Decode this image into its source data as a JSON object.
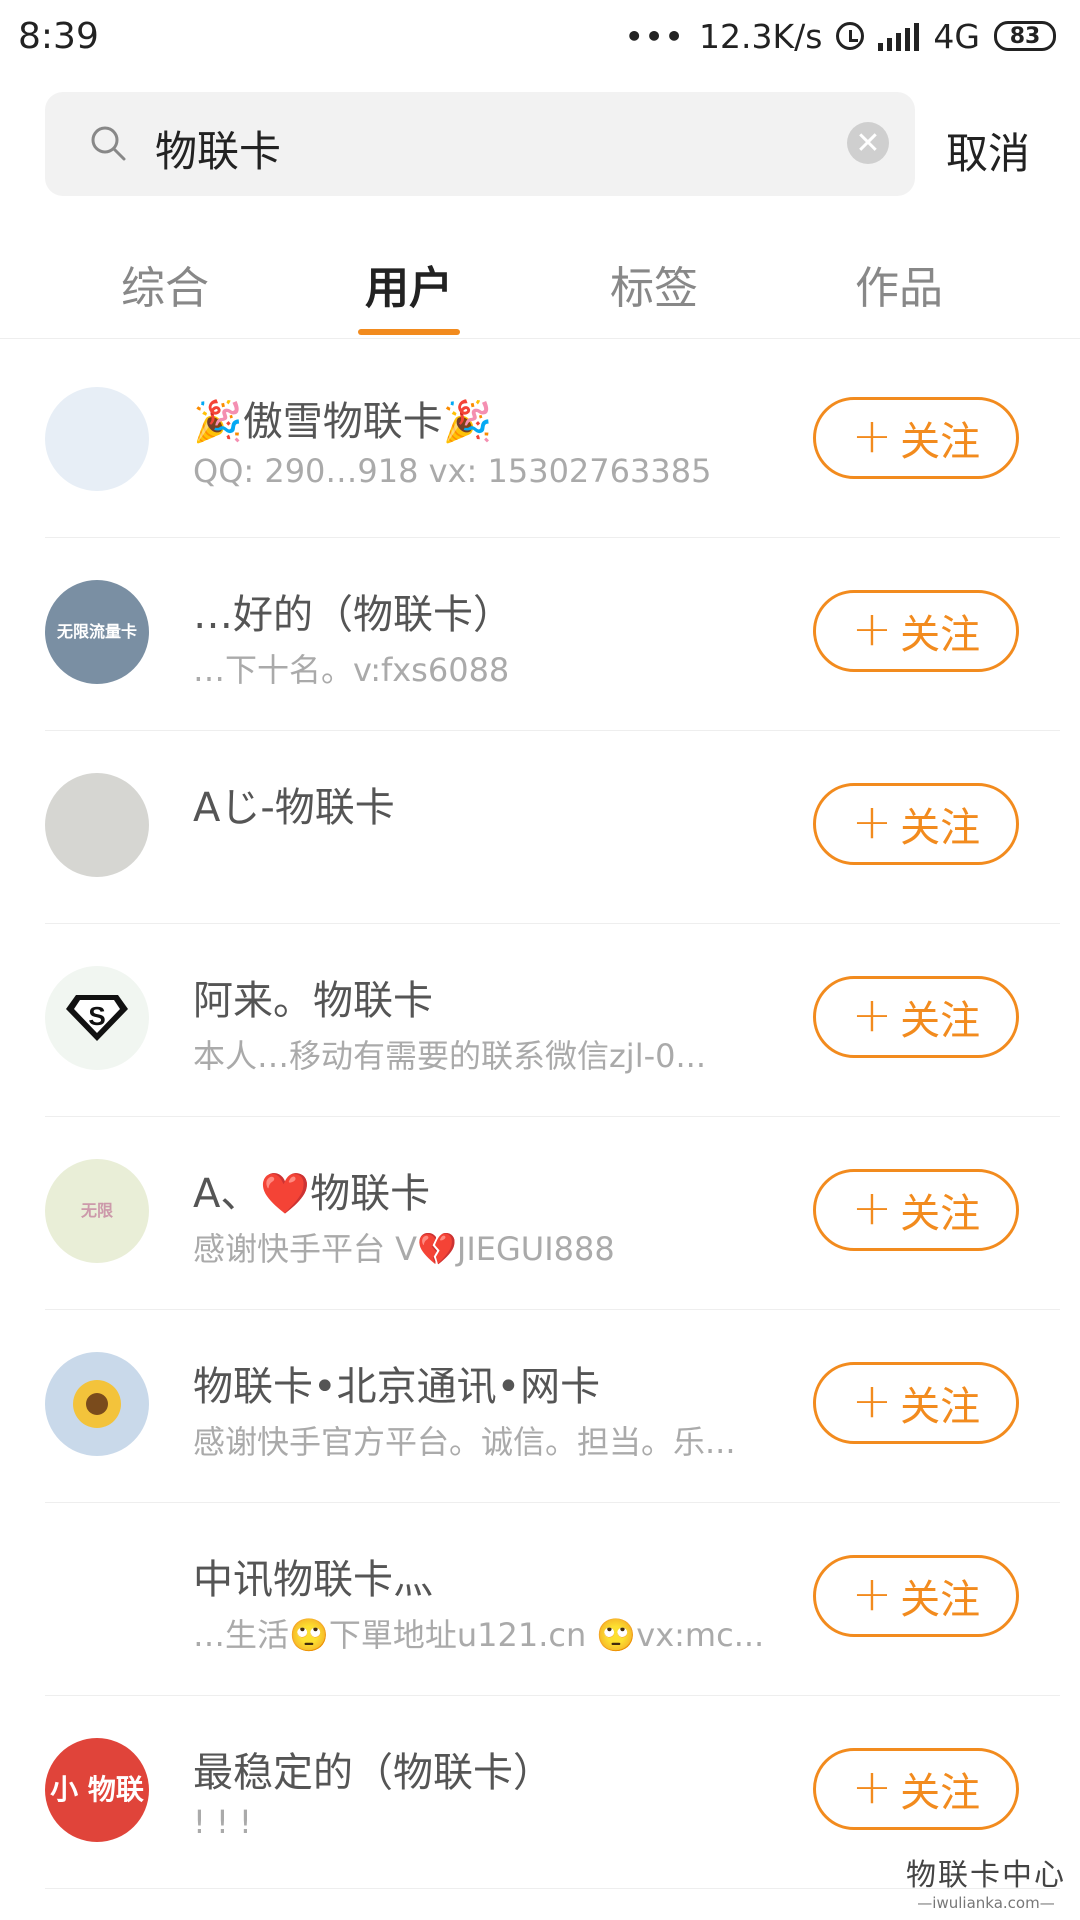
{
  "status_bar": {
    "time": "8:39",
    "dots": "•••",
    "speed": "12.3K/s",
    "network": "4G",
    "battery": "83"
  },
  "search": {
    "query": "物联卡",
    "clear_symbol": "✕",
    "cancel_label": "取消"
  },
  "tabs": [
    {
      "label": "综合"
    },
    {
      "label": "用户"
    },
    {
      "label": "标签"
    },
    {
      "label": "作品"
    }
  ],
  "active_tab": "用户",
  "follow_label": "关注",
  "follow_plus": "+",
  "users": [
    {
      "name": "🎉傲雪物联卡🎉",
      "desc": "QQ: 290…918 vx: 15302763385",
      "avatar_color": "#e7eef6",
      "avatar_text": ""
    },
    {
      "name": "…好的（物联卡）",
      "desc": "…下十名。v:fxs6088",
      "avatar_color": "#7a8fa3",
      "avatar_text": "无限流量卡"
    },
    {
      "name": "Aじ-物联卡",
      "desc": "",
      "avatar_color": "#d6d6d2",
      "avatar_text": ""
    },
    {
      "name": "阿来。物联卡",
      "desc": "本人…移动有需要的联系微信zjl-0...",
      "avatar_color": "#f1f6f1",
      "avatar_text": ""
    },
    {
      "name": "A、❤️物联卡",
      "desc": "感谢快手平台 V💔JIEGUI888",
      "avatar_color": "#e9eed7",
      "avatar_text": "无限"
    },
    {
      "name": "物联卡•北京通讯•网卡",
      "desc": "感谢快手官方平台。诚信。担当。乐...",
      "avatar_color": "#c9d9ea",
      "avatar_text": ""
    },
    {
      "name": "中讯物联卡灬",
      "desc": "…生活🙄下單地址u121.cn 🙄vx:mc...",
      "avatar_color": "#ffffff",
      "avatar_text": ""
    },
    {
      "name": "最稳定的（物联卡）",
      "desc": "! ! !",
      "avatar_color": "#e0443a",
      "avatar_text": "小 物联"
    }
  ],
  "watermark": {
    "title": "物联卡中心",
    "url": "—iwulianka.com—"
  }
}
